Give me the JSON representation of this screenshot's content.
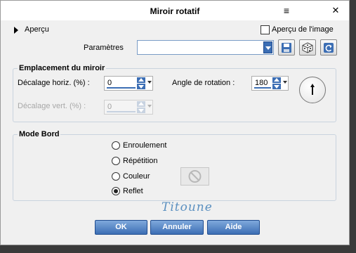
{
  "window": {
    "title": "Miroir rotatif",
    "menu_glyph": "≡",
    "close_glyph": "✕"
  },
  "preview": {
    "label": "Aperçu",
    "image_preview_label": "Aperçu de l'image",
    "image_preview_checked": false
  },
  "presets": {
    "label": "Paramètres",
    "value": ""
  },
  "mirror_group": {
    "legend": "Emplacement du miroir",
    "h_offset_label": "Décalage horiz. (%) :",
    "h_offset_value": "0",
    "v_offset_label": "Décalage vert. (%) :",
    "v_offset_value": "0",
    "rotation_label": "Angle de rotation :",
    "rotation_value": "180"
  },
  "edge_group": {
    "legend": "Mode Bord",
    "options": [
      "Enroulement",
      "Répétition",
      "Couleur",
      "Reflet"
    ],
    "selected": "Reflet"
  },
  "watermark": "Titoune",
  "buttons": {
    "ok": "OK",
    "cancel": "Annuler",
    "help": "Aide"
  },
  "colors": {
    "accent": "#3c6eb4",
    "background": "#f0f0f0"
  }
}
